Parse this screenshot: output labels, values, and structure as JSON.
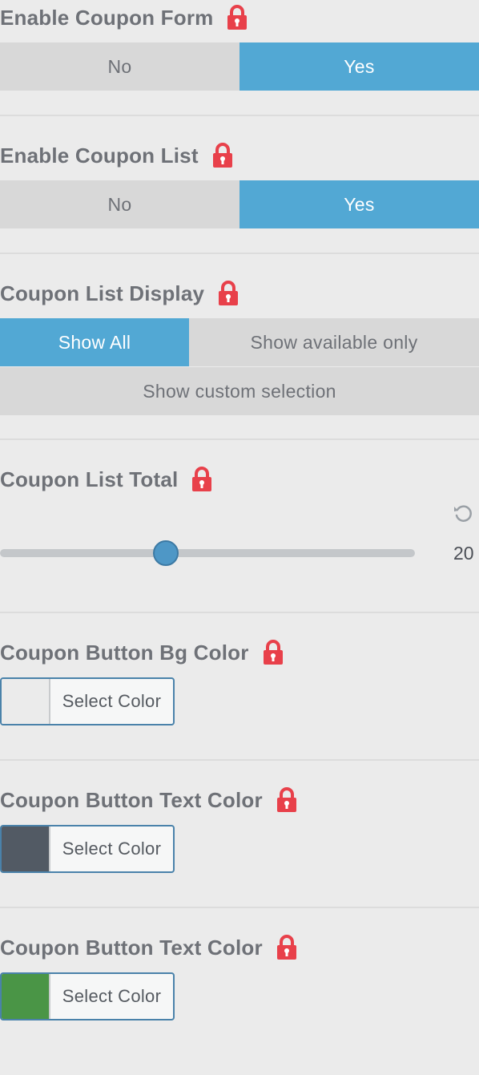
{
  "settings": {
    "coupon_form": {
      "label": "Enable Coupon Form",
      "options": [
        "No",
        "Yes"
      ],
      "selected": "Yes"
    },
    "coupon_list": {
      "label": "Enable Coupon List",
      "options": [
        "No",
        "Yes"
      ],
      "selected": "Yes"
    },
    "list_display": {
      "label": "Coupon List Display",
      "options": [
        "Show All",
        "Show available only",
        "Show custom selection"
      ],
      "selected": "Show All"
    },
    "list_total": {
      "label": "Coupon List Total",
      "value": "20",
      "slider_fraction": 0.4
    },
    "button_bg_color": {
      "label": "Coupon Button Bg Color",
      "picker_label": "Select Color",
      "swatch_color": "#ebebeb"
    },
    "button_text_color": {
      "label": "Coupon Button Text Color",
      "picker_label": "Select Color",
      "swatch_color": "#525a64"
    },
    "button_text_color_2": {
      "label": "Coupon Button Text Color",
      "picker_label": "Select Color",
      "swatch_color": "#4a9546"
    }
  },
  "colors": {
    "accent": "#52a8d4",
    "inactive": "#d8d8d8",
    "lock": "#e8404a",
    "slider_thumb": "#4e97c6"
  },
  "icons": {
    "lock": "lock-icon",
    "reset": "reset-icon"
  }
}
